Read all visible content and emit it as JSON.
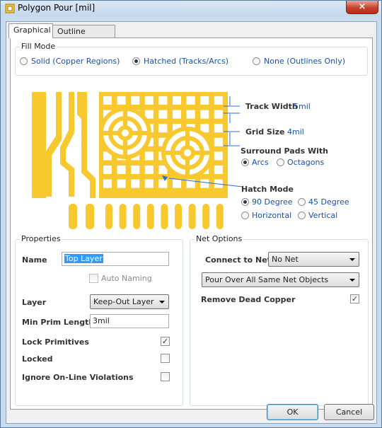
{
  "window": {
    "title": "Polygon Pour [mil]",
    "close_symbol": "×"
  },
  "tabs": [
    {
      "label": "Graphical"
    },
    {
      "label": "Outline Vertices"
    }
  ],
  "fill_mode": {
    "title": "Fill Mode",
    "options": [
      {
        "label": "Solid (Copper Regions)",
        "selected": false
      },
      {
        "label": "Hatched (Tracks/Arcs)",
        "selected": true
      },
      {
        "label": "None (Outlines Only)",
        "selected": false
      }
    ]
  },
  "hatch_settings": {
    "track_width_label": "Track Width",
    "track_width_value": "5mil",
    "grid_size_label": "Grid Size",
    "grid_size_value": "4mil",
    "surround_label": "Surround Pads With",
    "surround_options": [
      {
        "label": "Arcs",
        "selected": true
      },
      {
        "label": "Octagons",
        "selected": false
      }
    ],
    "hatch_mode_label": "Hatch Mode",
    "hatch_mode_options": [
      {
        "label": "90 Degree",
        "selected": true
      },
      {
        "label": "45 Degree",
        "selected": false
      },
      {
        "label": "Horizontal",
        "selected": false
      },
      {
        "label": "Vertical",
        "selected": false
      }
    ],
    "preview_color": "#f7c92f"
  },
  "properties": {
    "title": "Properties",
    "name_label": "Name",
    "name_value": "Top Layer",
    "auto_naming_label": "Auto Naming",
    "layer_label": "Layer",
    "layer_value": "Keep-Out Layer",
    "min_prim_label": "Min Prim Length",
    "min_prim_value": "3mil",
    "lock_primitives_label": "Lock Primitives",
    "lock_primitives_checked": true,
    "locked_label": "Locked",
    "locked_checked": false,
    "ignore_label": "Ignore On-Line Violations",
    "ignore_checked": false
  },
  "net_options": {
    "title": "Net Options",
    "connect_label": "Connect to Net",
    "connect_value": "No Net",
    "pour_value": "Pour Over All Same Net Objects",
    "remove_dead_label": "Remove Dead Copper",
    "remove_dead_checked": true
  },
  "buttons": {
    "ok": "OK",
    "cancel": "Cancel"
  },
  "check_mark": "✓"
}
